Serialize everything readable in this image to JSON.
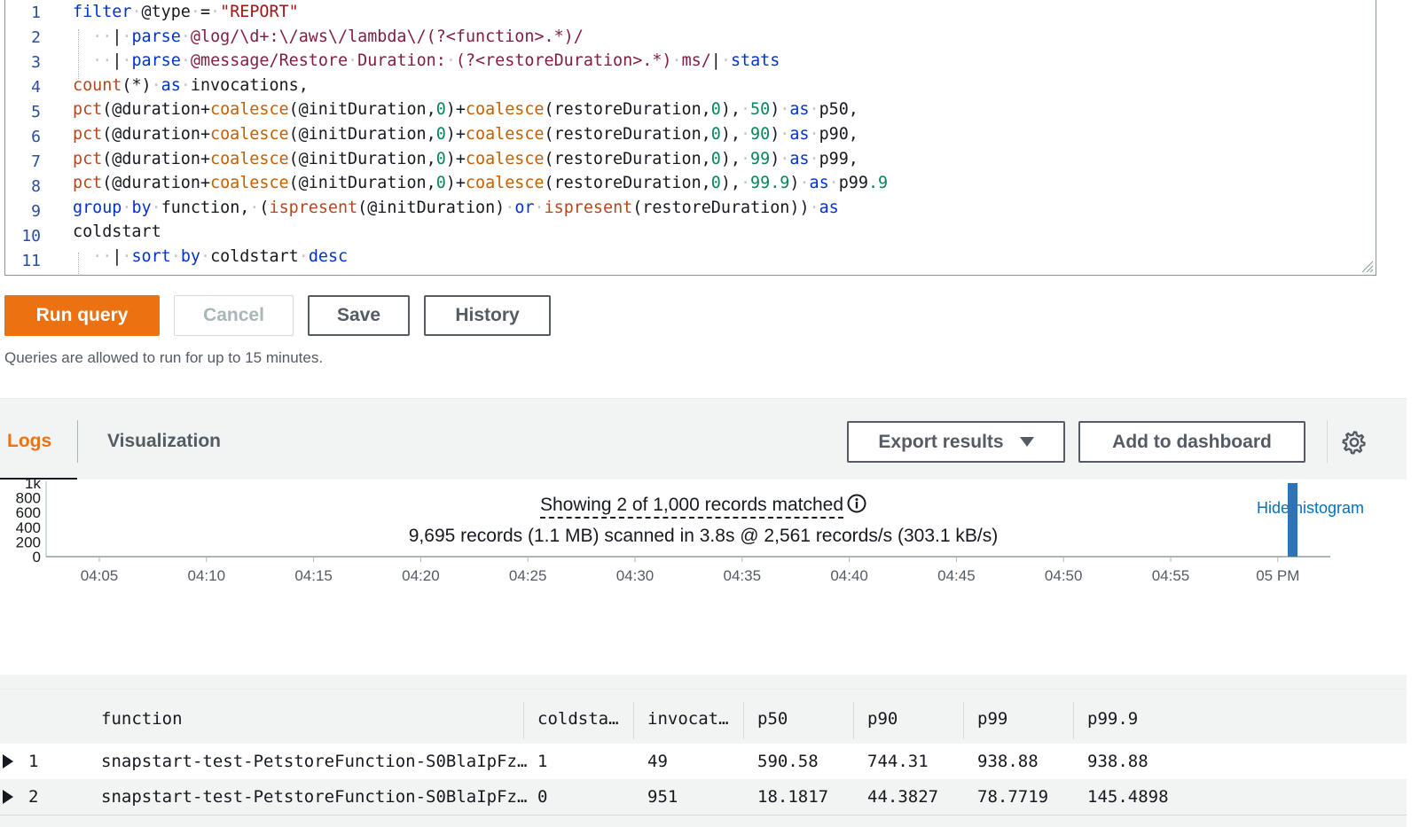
{
  "editor": {
    "line_numbers": [
      "1",
      "2",
      "3",
      "4",
      "5",
      "6",
      "7",
      "8",
      "9",
      "10",
      "11"
    ]
  },
  "buttons": {
    "run": "Run query",
    "cancel": "Cancel",
    "save": "Save",
    "history": "History"
  },
  "hint": "Queries are allowed to run for up to 15 minutes.",
  "tabs": {
    "logs": "Logs",
    "visualization": "Visualization"
  },
  "actions": {
    "export": "Export results",
    "add_dashboard": "Add to dashboard"
  },
  "summary": {
    "showing": "Showing 2 of 1,000 records matched",
    "scanned": "9,695 records (1.1 MB) scanned in 3.8s @ 2,561 records/s (303.1 kB/s)",
    "hide_histogram": "Hide histogram"
  },
  "chart_data": {
    "type": "bar",
    "y_ticks": [
      "1k",
      "800",
      "600",
      "400",
      "200",
      "0"
    ],
    "x_ticks": [
      "04:05",
      "04:10",
      "04:15",
      "04:20",
      "04:25",
      "04:30",
      "04:35",
      "04:40",
      "04:45",
      "04:50",
      "04:55",
      "05 PM"
    ],
    "ylim": [
      0,
      1000
    ],
    "bars": [
      {
        "x": "05:00",
        "value": 1000
      }
    ],
    "colors": {
      "bar": "#2e73b8"
    }
  },
  "table": {
    "headers": [
      "function",
      "coldsta…",
      "invocat…",
      "p50",
      "p90",
      "p99",
      "p99.9"
    ],
    "rows": [
      {
        "num": "1",
        "function": "snapstart-test-PetstoreFunction-S0BlaIpFz…",
        "coldstart": "1",
        "invocations": "49",
        "p50": "590.58",
        "p90": "744.31",
        "p99": "938.88",
        "p999": "938.88"
      },
      {
        "num": "2",
        "function": "snapstart-test-PetstoreFunction-S0BlaIpFz…",
        "coldstart": "0",
        "invocations": "951",
        "p50": "18.1817",
        "p90": "44.3827",
        "p99": "78.7719",
        "p999": "145.4898"
      }
    ]
  },
  "colors": {
    "accent": "#ec7211",
    "link": "#0073bb"
  }
}
